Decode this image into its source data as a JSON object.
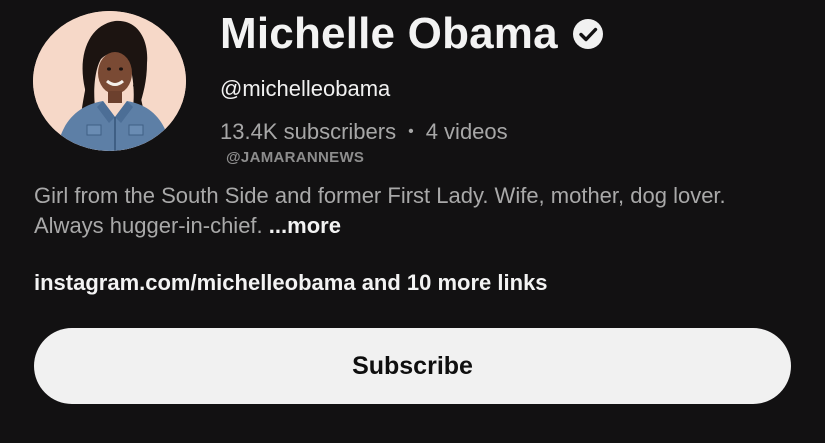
{
  "channel": {
    "name": "Michelle Obama",
    "handle": "@michelleobama",
    "subscribers": "13.4K subscribers",
    "separator": "•",
    "videos": "4 videos",
    "description_main": "Girl from the South Side and former First Lady. Wife, mother, dog lover. Always hugger-in-chief.",
    "description_more": "...more",
    "links_primary": "instagram.com/michelleobama",
    "links_more": "and 10 more links",
    "verified_icon": "verified-check-icon"
  },
  "watermark": "@JAMARANNEWS",
  "subscribe_button": {
    "label": "Subscribe"
  },
  "colors": {
    "background": "#121112",
    "primary_text": "#f3f3f3",
    "secondary_text": "#a9a9a9",
    "button_bg": "#f1f1f1",
    "button_text": "#0f0f0f"
  }
}
